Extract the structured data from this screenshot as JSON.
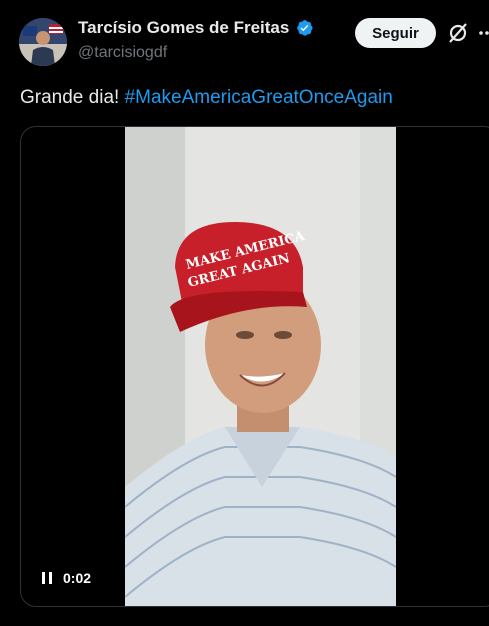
{
  "author": {
    "name": "Tarcísio Gomes de Freitas",
    "handle": "@tarcisiogdf",
    "verified": true
  },
  "header": {
    "follow_label": "Seguir"
  },
  "tweet": {
    "text": "Grande dia! ",
    "hashtag": "#MakeAmericaGreatOnceAgain"
  },
  "media": {
    "type": "video",
    "elapsed": "0:02",
    "cap_text_line1": "MAKE AMERICA",
    "cap_text_line2": "GREAT AGAIN"
  },
  "colors": {
    "background": "#000000",
    "text": "#e7e9ea",
    "secondary_text": "#71767b",
    "link": "#1d9bf0",
    "verified": "#1d9bf0",
    "cap_red": "#c8202a"
  },
  "icons": [
    "verified-badge-icon",
    "grok-icon",
    "more-icon",
    "pause-icon"
  ]
}
